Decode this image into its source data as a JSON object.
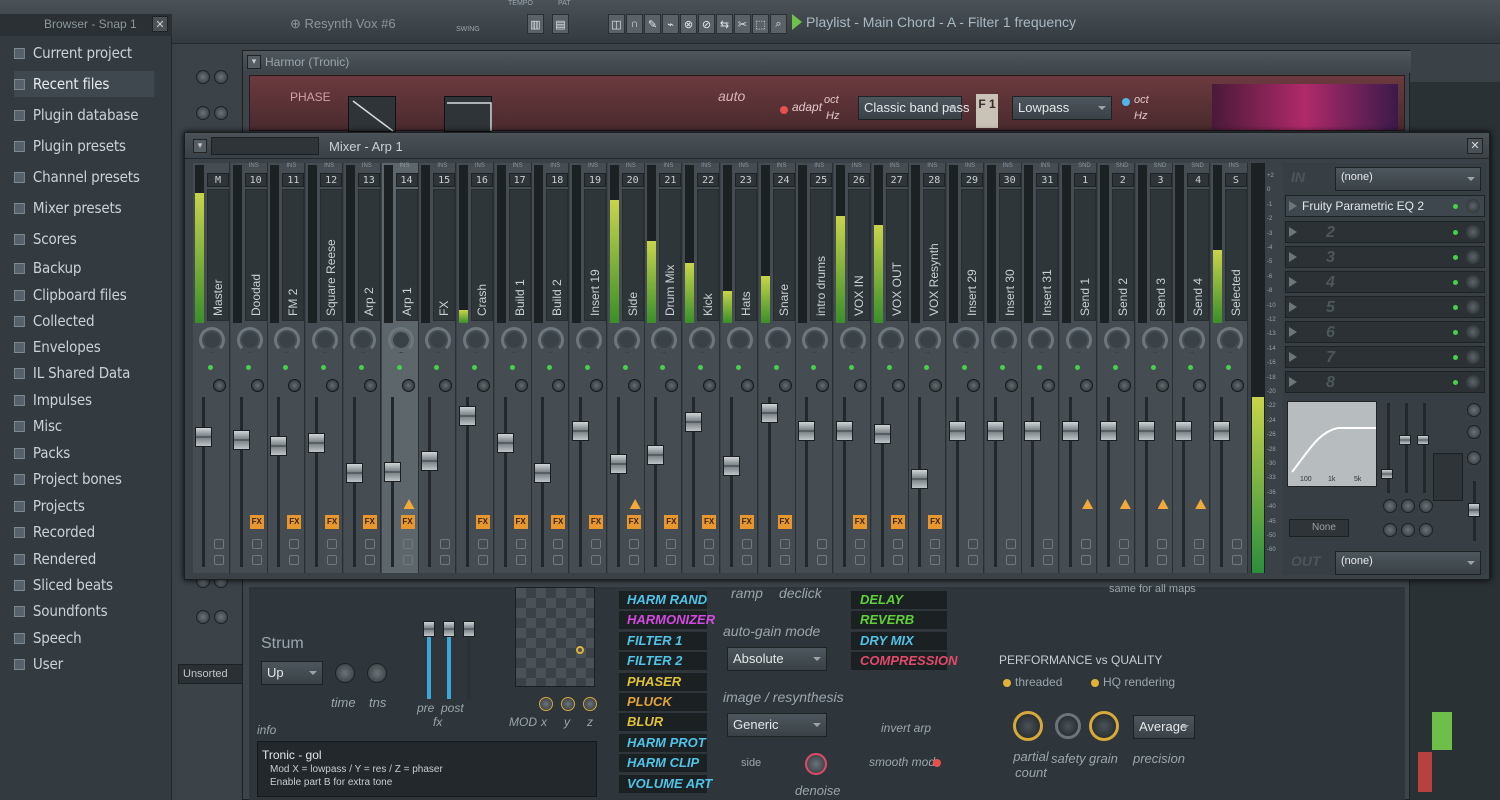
{
  "toolbar": {
    "playlist_title": "Playlist - Main Chord - A - Filter 1 frequency",
    "pattern_name": "Resynth Vox #6",
    "tempo_label": "TEMPO",
    "swing_label": "SWING",
    "pat_label": "PAT"
  },
  "browser": {
    "title": "Browser - Snap 1",
    "items": [
      "Current project",
      "Recent files",
      "Plugin database",
      "Plugin presets",
      "Channel presets",
      "Mixer presets",
      "Scores",
      "Backup",
      "Clipboard files",
      "Collected",
      "Envelopes",
      "IL Shared Data",
      "Impulses",
      "Misc",
      "Packs",
      "Project bones",
      "Projects",
      "Recorded",
      "Rendered",
      "Sliced beats",
      "Soundfonts",
      "Speech",
      "User"
    ],
    "unsorted": "Unsorted"
  },
  "harmor": {
    "title": "Harmor (Tronic)",
    "phase": "PHASE",
    "auto": "auto",
    "adapt": "adapt",
    "oct": "oct",
    "hz": "Hz",
    "filter_type": "Classic band pass",
    "filter_mode": "Lowpass",
    "filter_badge": "F 1",
    "strum": "Strum",
    "strum_value": "Up",
    "time": "time",
    "tns": "tns",
    "pre": "pre",
    "post": "post",
    "fx": "fx",
    "mod": "MOD",
    "x": "x",
    "y": "y",
    "z": "z",
    "info_label": "info",
    "info_title": "Tronic - gol",
    "info_line1": "Mod X = lowpass / Y = res / Z = phaser",
    "info_line2": "Enable part B for extra tone",
    "fx_left": [
      {
        "label": "HARM RAND",
        "color": "#4fc4e8"
      },
      {
        "label": "HARMONIZER",
        "color": "#d24adf"
      },
      {
        "label": "FILTER 1",
        "color": "#4fc4e8"
      },
      {
        "label": "FILTER 2",
        "color": "#4fc4e8"
      },
      {
        "label": "PHASER",
        "color": "#e0c23a"
      },
      {
        "label": "PLUCK",
        "color": "#e0a23a"
      },
      {
        "label": "BLUR",
        "color": "#e0c23a"
      },
      {
        "label": "HARM PROT",
        "color": "#4fc4e8"
      },
      {
        "label": "HARM CLIP",
        "color": "#4fc4e8"
      },
      {
        "label": "VOLUME ART",
        "color": "#4fc4e8"
      }
    ],
    "fx_right": [
      {
        "label": "DELAY",
        "color": "#5fd13a"
      },
      {
        "label": "REVERB",
        "color": "#5fd13a"
      },
      {
        "label": "DRY MIX",
        "color": "#4fc4e8"
      },
      {
        "label": "COMPRESSION",
        "color": "#e24a6a"
      }
    ],
    "ramp": "ramp",
    "declick": "declick",
    "auto_gain_mode": "auto-gain mode",
    "auto_gain_value": "Absolute",
    "image_resynth": "image / resynthesis",
    "image_value": "Generic",
    "side": "side",
    "denoise": "denoise",
    "invert_arp": "invert arp",
    "smooth_mod": "smooth mod",
    "same_for_all_maps": "same for all maps",
    "perf_title": "PERFORMANCE vs QUALITY",
    "threaded": "threaded",
    "hq": "HQ rendering",
    "partial_count": "partial count",
    "safety": "safety",
    "grain": "grain",
    "precision": "precision",
    "precision_value": "Average"
  },
  "mixer": {
    "title": "Mixer - Arp 1",
    "ins_label": "INS",
    "snd_label": "SND",
    "master_label": "M",
    "selected_label": "S",
    "strips": [
      {
        "num": "M",
        "name": "Master",
        "meter": 0.82,
        "fader": 0.2,
        "fx": false,
        "route": false
      },
      {
        "num": "10",
        "name": "Doodad",
        "meter": 0.0,
        "fader": 0.22,
        "fx": true,
        "route": false
      },
      {
        "num": "11",
        "name": "FM 2",
        "meter": 0.0,
        "fader": 0.26,
        "fx": true,
        "route": false
      },
      {
        "num": "12",
        "name": "Square Reese",
        "meter": 0.0,
        "fader": 0.24,
        "fx": true,
        "route": false
      },
      {
        "num": "13",
        "name": "Arp 2",
        "meter": 0.0,
        "fader": 0.44,
        "fx": true,
        "route": false
      },
      {
        "num": "14",
        "name": "Arp 1",
        "meter": 0.0,
        "fader": 0.43,
        "fx": true,
        "route": true
      },
      {
        "num": "15",
        "name": "FX",
        "meter": 0.0,
        "fader": 0.36,
        "fx": false,
        "route": false
      },
      {
        "num": "16",
        "name": "Crash",
        "meter": 0.08,
        "fader": 0.06,
        "fx": true,
        "route": false
      },
      {
        "num": "17",
        "name": "Build 1",
        "meter": 0.0,
        "fader": 0.24,
        "fx": true,
        "route": false
      },
      {
        "num": "18",
        "name": "Build 2",
        "meter": 0.0,
        "fader": 0.44,
        "fx": true,
        "route": false
      },
      {
        "num": "19",
        "name": "Insert 19",
        "meter": 0.0,
        "fader": 0.16,
        "fx": true,
        "route": false
      },
      {
        "num": "20",
        "name": "Side",
        "meter": 0.78,
        "fader": 0.38,
        "fx": true,
        "route": true
      },
      {
        "num": "21",
        "name": "Drum Mix",
        "meter": 0.52,
        "fader": 0.32,
        "fx": true,
        "route": false
      },
      {
        "num": "22",
        "name": "Kick",
        "meter": 0.38,
        "fader": 0.1,
        "fx": true,
        "route": false
      },
      {
        "num": "23",
        "name": "Hats",
        "meter": 0.2,
        "fader": 0.39,
        "fx": true,
        "route": false
      },
      {
        "num": "24",
        "name": "Snare",
        "meter": 0.3,
        "fader": 0.04,
        "fx": true,
        "route": false
      },
      {
        "num": "25",
        "name": "intro drums",
        "meter": 0.0,
        "fader": 0.16,
        "fx": false,
        "route": false
      },
      {
        "num": "26",
        "name": "VOX IN",
        "meter": 0.68,
        "fader": 0.16,
        "fx": true,
        "route": false
      },
      {
        "num": "27",
        "name": "VOX OUT",
        "meter": 0.62,
        "fader": 0.18,
        "fx": true,
        "route": false
      },
      {
        "num": "28",
        "name": "VOX Resynth",
        "meter": 0.0,
        "fader": 0.48,
        "fx": true,
        "route": false
      },
      {
        "num": "29",
        "name": "Insert 29",
        "meter": 0.0,
        "fader": 0.16,
        "fx": false,
        "route": false
      },
      {
        "num": "30",
        "name": "Insert 30",
        "meter": 0.0,
        "fader": 0.16,
        "fx": false,
        "route": false
      },
      {
        "num": "31",
        "name": "Insert 31",
        "meter": 0.0,
        "fader": 0.16,
        "fx": false,
        "route": false
      },
      {
        "num": "1",
        "name": "Send 1",
        "meter": 0.0,
        "fader": 0.16,
        "fx": false,
        "route": true
      },
      {
        "num": "2",
        "name": "Send 2",
        "meter": 0.0,
        "fader": 0.16,
        "fx": false,
        "route": true
      },
      {
        "num": "3",
        "name": "Send 3",
        "meter": 0.0,
        "fader": 0.16,
        "fx": false,
        "route": true
      },
      {
        "num": "4",
        "name": "Send 4",
        "meter": 0.0,
        "fader": 0.16,
        "fx": false,
        "route": true
      },
      {
        "num": "S",
        "name": "Selected",
        "meter": 0.46,
        "fader": 0.16,
        "fx": false,
        "route": false
      }
    ],
    "in_label": "IN",
    "in_value": "(none)",
    "out_label": "OUT",
    "out_value": "(none)",
    "slot1": "Fruity Parametric EQ 2",
    "slots": [
      "2",
      "3",
      "4",
      "5",
      "6",
      "7",
      "8"
    ],
    "eq_none": "None",
    "eq_freqs": [
      "100",
      "1k",
      "5k"
    ],
    "db_ticks": [
      "+2",
      "0",
      "-1",
      "-2",
      "-3",
      "-4",
      "-5",
      "-6",
      "-8",
      "-10",
      "-12",
      "-13",
      "-14",
      "-16",
      "-18",
      "-20",
      "-22",
      "-24",
      "-26",
      "-28",
      "-30",
      "-33",
      "-36",
      "-40",
      "-45",
      "-50",
      "-60"
    ]
  }
}
